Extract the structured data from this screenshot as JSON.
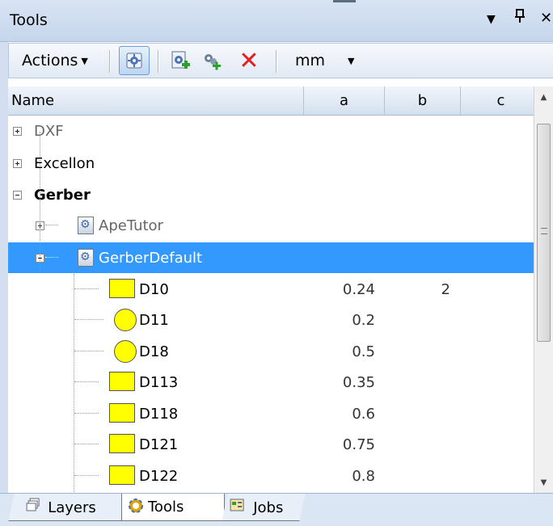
{
  "window": {
    "title": "Tools",
    "menu_glyph": "▼",
    "pin_glyph": "p",
    "close_glyph": "✕"
  },
  "toolbar": {
    "actions_label": "Actions",
    "unit_value": "mm",
    "icons": [
      "settings-icon",
      "tool-library-add-icon",
      "add-tool-icon",
      "delete-icon"
    ],
    "delete_glyph": "✕"
  },
  "columns": {
    "name": "Name",
    "a": "a",
    "b": "b",
    "c": "c"
  },
  "tree": {
    "groups": [
      {
        "label": "DXF"
      },
      {
        "label": "Excellon"
      },
      {
        "label": "Gerber"
      }
    ],
    "libraries": [
      {
        "label": "ApeTutor"
      },
      {
        "label": "GerberDefault"
      }
    ],
    "apertures": [
      {
        "name": "D10",
        "shape": "square",
        "a": "0.24",
        "b": "2"
      },
      {
        "name": "D11",
        "shape": "circle",
        "a": "0.2",
        "b": ""
      },
      {
        "name": "D18",
        "shape": "circle",
        "a": "0.5",
        "b": ""
      },
      {
        "name": "D113",
        "shape": "square",
        "a": "0.35",
        "b": ""
      },
      {
        "name": "D118",
        "shape": "square",
        "a": "0.6",
        "b": ""
      },
      {
        "name": "D121",
        "shape": "square",
        "a": "0.75",
        "b": ""
      },
      {
        "name": "D122",
        "shape": "square",
        "a": "0.8",
        "b": ""
      }
    ]
  },
  "tabs": [
    {
      "label": "Layers",
      "icon": "layers-icon"
    },
    {
      "label": "Tools",
      "icon": "tools-icon",
      "active": true
    },
    {
      "label": "Jobs",
      "icon": "jobs-icon"
    }
  ],
  "colors": {
    "selection": "#3399ff",
    "aperture_fill": "#ffff00",
    "delete": "#e02020"
  }
}
